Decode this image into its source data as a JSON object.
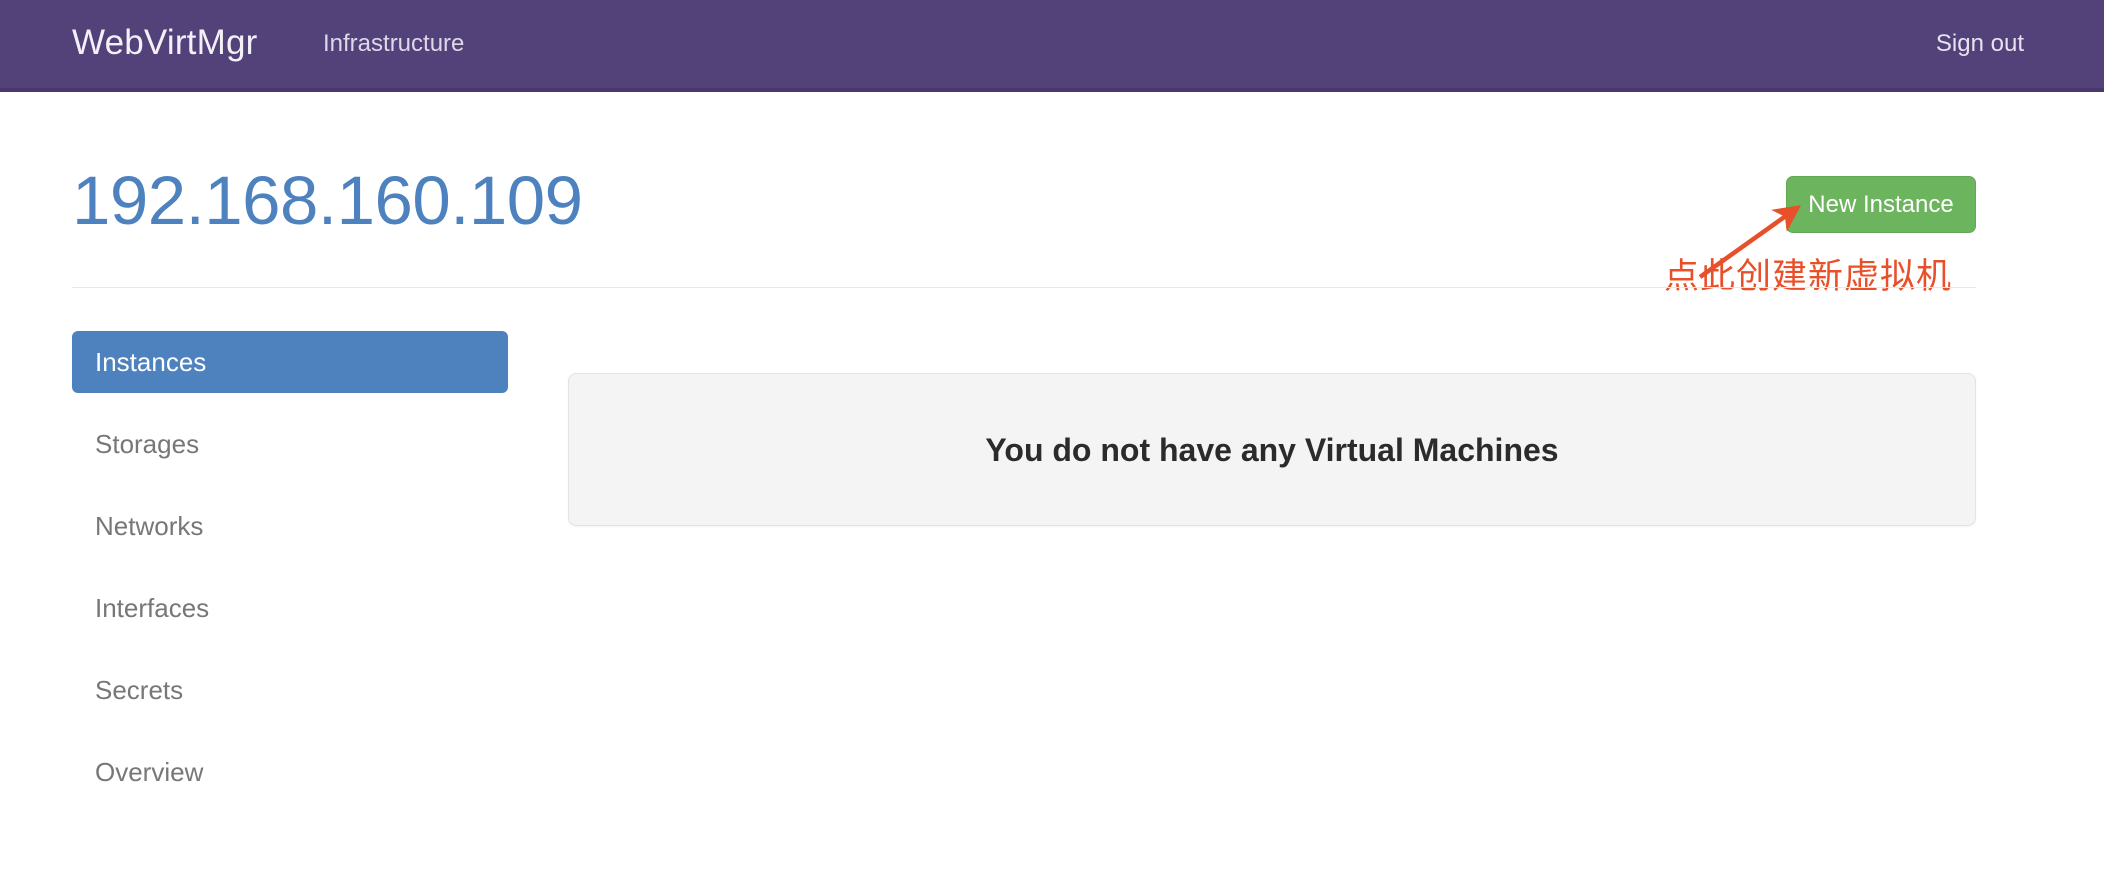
{
  "navbar": {
    "brand": "WebVirtMgr",
    "infrastructure_label": "Infrastructure",
    "signout_label": "Sign out",
    "background_color": "#534279"
  },
  "header": {
    "title": "192.168.160.109",
    "title_color": "#4d82be",
    "new_instance_label": "New Instance",
    "new_instance_color": "#6cb45e"
  },
  "annotation": {
    "text": "点此创建新虚拟机",
    "color": "#e8502a",
    "icon": "arrow-up-right-icon"
  },
  "sidebar": {
    "items": [
      {
        "label": "Instances",
        "active": true
      },
      {
        "label": "Storages",
        "active": false
      },
      {
        "label": "Networks",
        "active": false
      },
      {
        "label": "Interfaces",
        "active": false
      },
      {
        "label": "Secrets",
        "active": false
      },
      {
        "label": "Overview",
        "active": false
      }
    ],
    "active_color": "#4d82be",
    "inactive_color": "#777777"
  },
  "main": {
    "empty_message": "You do not have any Virtual Machines",
    "panel_background": "#f4f4f4"
  }
}
